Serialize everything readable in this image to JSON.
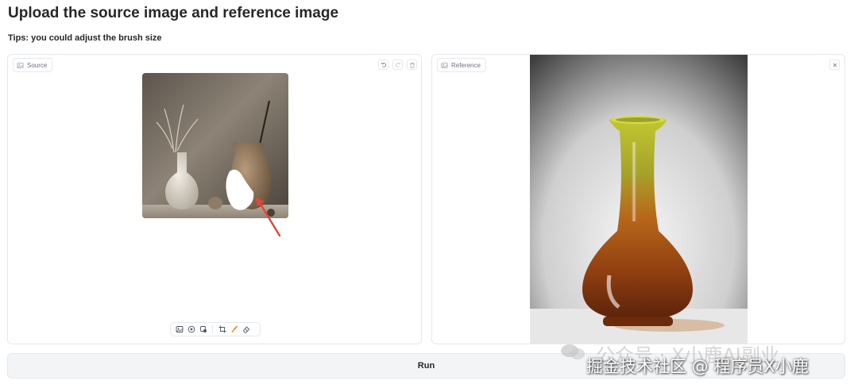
{
  "page": {
    "title": "Upload the source image and reference image",
    "tips": "Tips: you could adjust the brush size"
  },
  "source_panel": {
    "label": "Source",
    "label_icon": "image-icon",
    "tools": [
      "undo-icon",
      "redo-icon",
      "trash-icon"
    ],
    "brush_toolbar": [
      "image-icon",
      "paint-icon",
      "layers-icon",
      "crop-icon",
      "brush-icon",
      "eraser-icon"
    ]
  },
  "reference_panel": {
    "label": "Reference",
    "label_icon": "image-icon",
    "tools": [
      "close-icon"
    ]
  },
  "run_button": {
    "label": "Run"
  },
  "watermark": {
    "line1": "公众号 · X小鹿AI副业",
    "line2": "掘金技术社区 @ 程序员X小鹿"
  },
  "colors": {
    "arrow": "#e0463a",
    "vase_top": "#b8bf2a",
    "vase_bottom": "#7a3a12",
    "border": "#e5e7eb"
  }
}
